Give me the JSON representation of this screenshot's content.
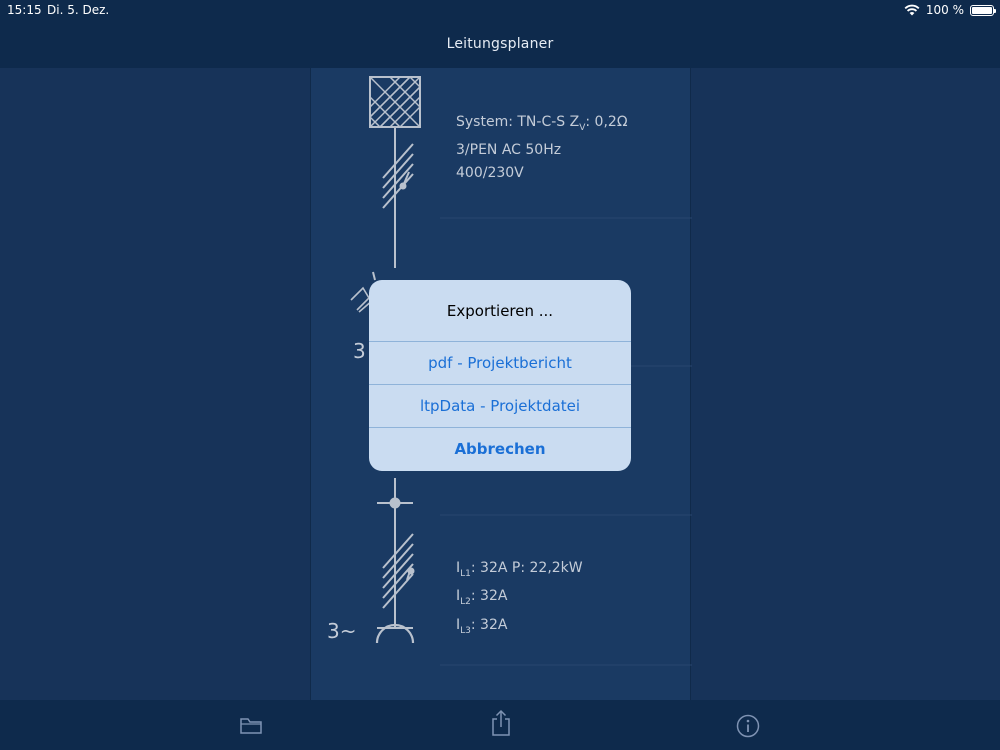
{
  "status_bar": {
    "time": "15:15",
    "date": "Di. 5. Dez.",
    "battery": "100 %"
  },
  "nav": {
    "title": "Leitungsplaner"
  },
  "diagram": {
    "supply": {
      "line1": "System: TN-C-S  Z",
      "line1_sub": "V",
      "line1_tail": ": 0,2Ω",
      "line2": "3/PEN AC 50Hz",
      "line3": "400/230V"
    },
    "consumer": {
      "l1_label": "I",
      "l1_sub": "L1",
      "l1_value": ": 32A  P: 22,2kW",
      "l2_label": "I",
      "l2_sub": "L2",
      "l2_value": ": 32A",
      "l3_label": "I",
      "l3_sub": "L3",
      "l3_value": ": 32A",
      "phase_symbol": "3~"
    },
    "mid_phase_symbol": "3"
  },
  "alert": {
    "title": "Exportieren ...",
    "buttons": [
      {
        "label": "pdf - Projektbericht"
      },
      {
        "label": "ltpData - Projektdatei"
      },
      {
        "label": "Abbrechen"
      }
    ]
  },
  "toolbar": {
    "icons": [
      "folder-icon",
      "share-icon",
      "info-icon"
    ]
  },
  "colors": {
    "background": "#173359",
    "bar": "#0e2a4c",
    "alert_background": "#cadcf1",
    "alert_button": "#1a6fd6",
    "diagram_stroke": "#b9c1cd"
  }
}
